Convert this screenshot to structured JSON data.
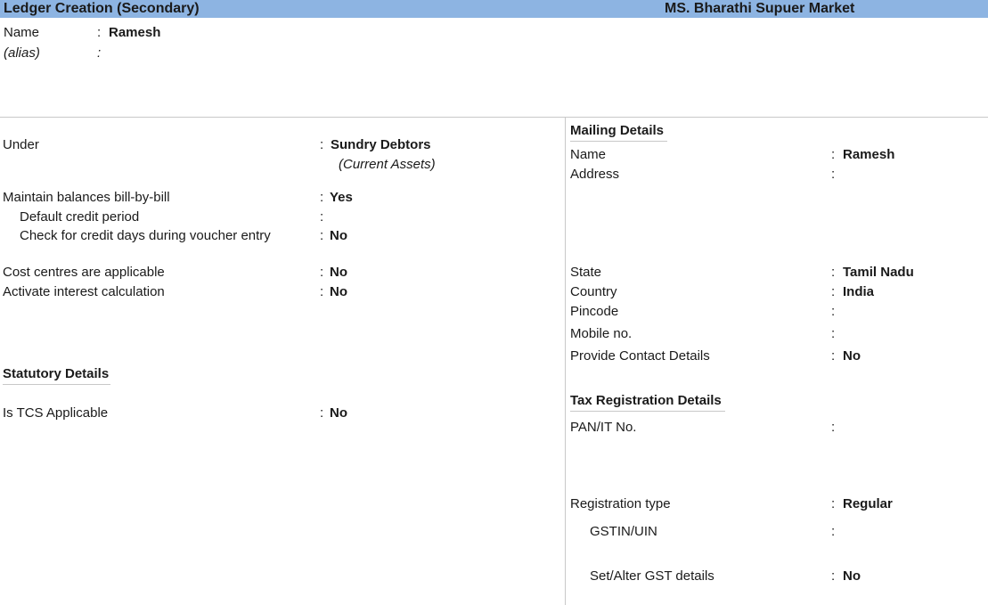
{
  "window": {
    "title": "Ledger Creation (Secondary)",
    "company": "MS. Bharathi Supuer Market"
  },
  "header": {
    "name_label": "Name",
    "name_value": "Ramesh",
    "alias_label": "(alias)",
    "alias_value": ""
  },
  "left": {
    "under_label": "Under",
    "under_value": "Sundry Debtors",
    "under_sub": "(Current Assets)",
    "billwise_label": "Maintain balances bill-by-bill",
    "billwise_value": "Yes",
    "credit_period_label": "Default credit period",
    "credit_period_value": "",
    "credit_check_label": "Check for credit days during voucher entry",
    "credit_check_value": "No",
    "cost_centres_label": "Cost centres are applicable",
    "cost_centres_value": "No",
    "interest_label": "Activate interest calculation",
    "interest_value": "No",
    "statutory_heading": "Statutory Details",
    "tcs_label": "Is TCS Applicable",
    "tcs_value": "No"
  },
  "mailing": {
    "heading": "Mailing Details",
    "name_label": "Name",
    "name_value": "Ramesh",
    "address_label": "Address",
    "address_value": "",
    "state_label": "State",
    "state_value": "Tamil Nadu",
    "country_label": "Country",
    "country_value": "India",
    "pincode_label": "Pincode",
    "pincode_value": "",
    "mobile_label": "Mobile no.",
    "mobile_value": "",
    "contact_label": "Provide Contact Details",
    "contact_value": "No"
  },
  "tax": {
    "heading": "Tax Registration Details",
    "pan_label": "PAN/IT No.",
    "pan_value": "",
    "regtype_label": "Registration type",
    "regtype_value": "Regular",
    "gstin_label": "GSTIN/UIN",
    "gstin_value": "",
    "gst_details_label": "Set/Alter GST details",
    "gst_details_value": "No"
  },
  "separator": ":"
}
